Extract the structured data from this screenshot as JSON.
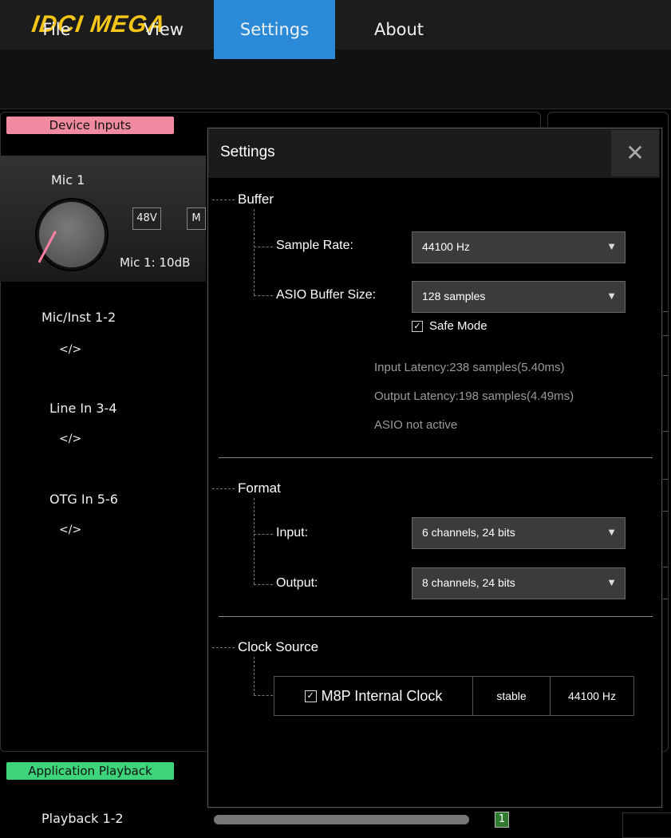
{
  "logo": {
    "text": "IDCI MEGA",
    "color": "#f5c518"
  },
  "menu": {
    "items": [
      {
        "label": "File"
      },
      {
        "label": "View"
      },
      {
        "label": "Settings",
        "active": true
      },
      {
        "label": "About"
      }
    ],
    "active_color": "#2a8ad8"
  },
  "left": {
    "device_inputs": "Device Inputs",
    "mic1": {
      "name": "Mic 1",
      "phantom": "48V",
      "mute_partial": "M",
      "gain": "Mic 1: 10dB"
    },
    "channels": [
      {
        "name": "Mic/Inst 1-2",
        "link": "</>"
      },
      {
        "name": "Line In 3-4",
        "link": "</>"
      },
      {
        "name": "OTG In 5-6",
        "link": "</>"
      }
    ],
    "application_playback": "Application Playback",
    "playback": {
      "name": "Playback 1-2",
      "indicator": "1"
    }
  },
  "dialog": {
    "title": "Settings",
    "close_glyph": "✕",
    "buffer": {
      "title": "Buffer",
      "sample_rate_label": "Sample Rate:",
      "sample_rate_value": "44100 Hz",
      "asio_label": "ASIO Buffer Size:",
      "asio_value": "128 samples",
      "safe_mode_label": "Safe Mode",
      "safe_mode_checked": true,
      "input_latency": "Input Latency:238 samples(5.40ms)",
      "output_latency": "Output Latency:198 samples(4.49ms)",
      "asio_status": "ASIO not active"
    },
    "format": {
      "title": "Format",
      "input_label": "Input:",
      "input_value": "6 channels, 24 bits",
      "output_label": "Output:",
      "output_value": "8 channels, 24 bits"
    },
    "clock": {
      "title": "Clock Source",
      "name": "M8P Internal Clock",
      "checked": true,
      "status": "stable",
      "rate": "44100 Hz"
    }
  }
}
